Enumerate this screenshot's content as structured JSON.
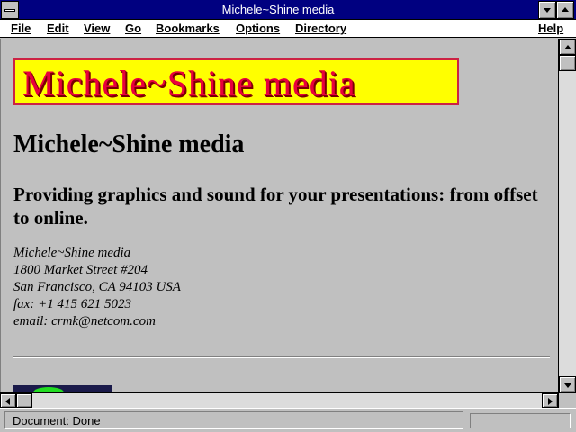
{
  "window": {
    "title": "Michele~Shine media"
  },
  "menu": {
    "items": [
      {
        "label": "File"
      },
      {
        "label": "Edit"
      },
      {
        "label": "View"
      },
      {
        "label": "Go"
      },
      {
        "label": "Bookmarks"
      },
      {
        "label": "Options"
      },
      {
        "label": "Directory"
      },
      {
        "label": "Help"
      }
    ]
  },
  "page": {
    "banner_text": "Michele~Shine media",
    "heading": "Michele~Shine media",
    "subheading": "Providing graphics and sound for your presentations: from offset to online.",
    "address": [
      "Michele~Shine media",
      "1800 Market Street #204",
      "San Francisco, CA 94103 USA",
      "fax: +1 415 621 5023",
      "email: crmk@netcom.com"
    ]
  },
  "status": {
    "text": "Document: Done",
    "progress": 0
  },
  "colors": {
    "titlebar": "#000080",
    "banner_bg": "#ffff00",
    "banner_text": "#e8003c",
    "window_bg": "#c0c0c0"
  }
}
